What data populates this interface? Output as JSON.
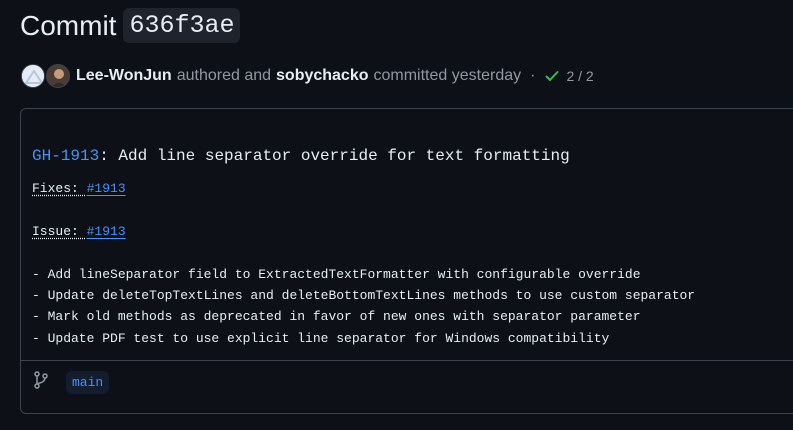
{
  "header": {
    "title_word": "Commit",
    "sha": "636f3ae"
  },
  "meta": {
    "author": "Lee-WonJun",
    "authored_text": "authored and",
    "committer": "sobychacko",
    "committed_text": "committed yesterday",
    "separator": "·",
    "checks": "2 / 2",
    "check_color": "#3fb950"
  },
  "commit": {
    "title_issue": "GH-1913",
    "title_rest": ": Add line separator override for text formatting",
    "fixes_label": "Fixes: ",
    "fixes_ref": "#1913",
    "issue_label": "Issue: ",
    "issue_ref": "#1913",
    "bullets": [
      "- Add lineSeparator field to ExtractedTextFormatter with configurable override",
      "- Update deleteTopTextLines and deleteBottomTextLines methods to use custom separator",
      "- Mark old methods as deprecated in favor of new ones with separator parameter",
      "- Update PDF test to use explicit line separator for Windows compatibility"
    ]
  },
  "footer": {
    "branch": "main",
    "icon": "git-branch-icon"
  }
}
